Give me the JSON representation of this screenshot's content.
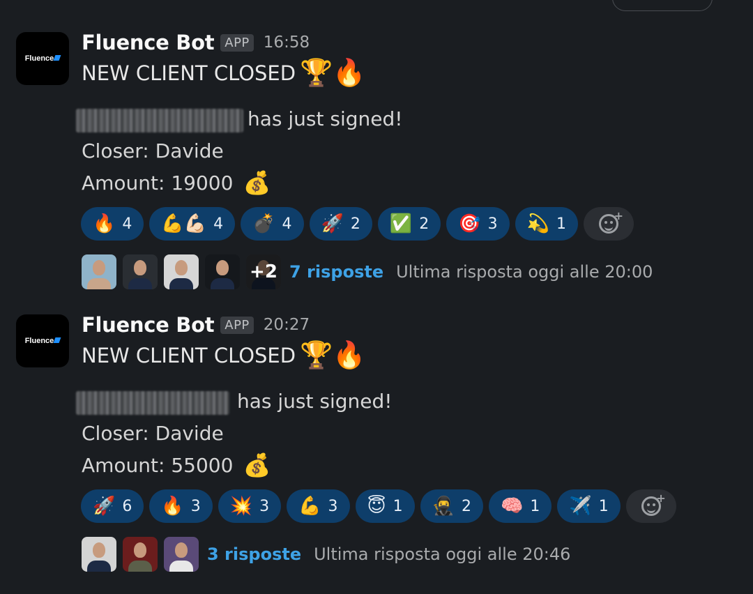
{
  "messages": [
    {
      "sender": "Fluence Bot",
      "badge": "APP",
      "time": "16:58",
      "logo_text": "Fluence",
      "title": "NEW CLIENT CLOSED",
      "title_emojis": "🏆🔥",
      "signed_text": "has just signed!",
      "closer": "Closer: Davide",
      "amount": "Amount: 19000",
      "amount_emoji": "💰",
      "reactions": [
        {
          "emoji": "🔥",
          "count": "4"
        },
        {
          "emoji": "💪💪🏻",
          "count": "4"
        },
        {
          "emoji": "💣",
          "count": "4"
        },
        {
          "emoji": "🚀",
          "count": "2"
        },
        {
          "emoji": "✅",
          "count": "2"
        },
        {
          "emoji": "🎯",
          "count": "3"
        },
        {
          "emoji": "💫",
          "count": "1"
        }
      ],
      "extra_participants": "+2",
      "replies": "7 risposte",
      "last_reply": "Ultima risposta oggi alle 20:00"
    },
    {
      "sender": "Fluence Bot",
      "badge": "APP",
      "time": "20:27",
      "logo_text": "Fluence",
      "title": "NEW CLIENT CLOSED",
      "title_emojis": "🏆🔥",
      "signed_text": "has just signed!",
      "closer": "Closer: Davide",
      "amount": "Amount: 55000",
      "amount_emoji": "💰",
      "reactions": [
        {
          "emoji": "🚀",
          "count": "6"
        },
        {
          "emoji": "🔥",
          "count": "3"
        },
        {
          "emoji": "💥",
          "count": "3"
        },
        {
          "emoji": "💪",
          "count": "3"
        },
        {
          "emoji": "😇",
          "count": "1"
        },
        {
          "emoji": "🥷",
          "count": "2"
        },
        {
          "emoji": "🧠",
          "count": "1"
        },
        {
          "emoji": "✈️",
          "count": "1"
        }
      ],
      "replies": "3 risposte",
      "last_reply": "Ultima risposta oggi alle 20:46"
    }
  ]
}
